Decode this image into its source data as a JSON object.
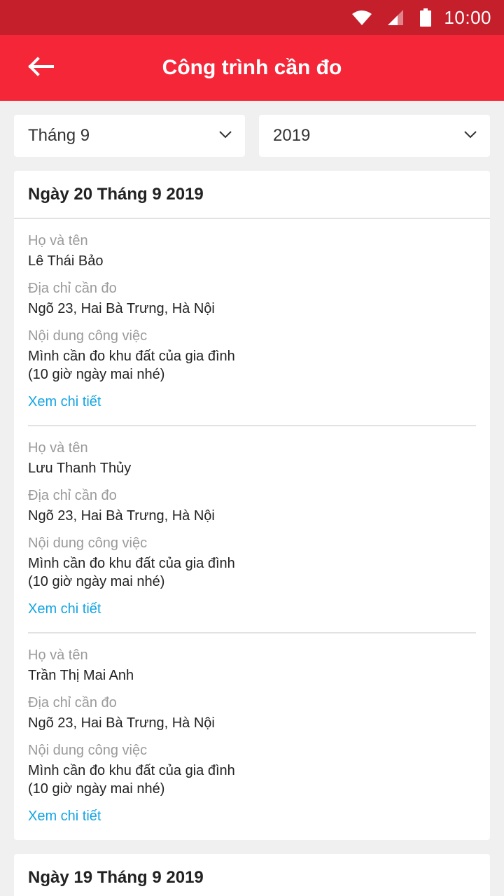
{
  "status_bar": {
    "time": "10:00"
  },
  "app_bar": {
    "title": "Công trình cần đo"
  },
  "filters": {
    "month": "Tháng 9",
    "year": "2019"
  },
  "groups": [
    {
      "date": "Ngày 20 Tháng 9 2019",
      "entries": [
        {
          "name_label": "Họ và tên",
          "name": "Lê Thái Bảo",
          "address_label": "Địa chỉ cần đo",
          "address": "Ngõ 23, Hai Bà Trưng, Hà Nội",
          "content_label": "Nội dung công việc",
          "content_line1": "Mình cần đo khu đất của gia đình",
          "content_line2": "(10 giờ ngày mai nhé)",
          "details_link": "Xem chi tiết"
        },
        {
          "name_label": "Họ và tên",
          "name": "Lưu Thanh Thủy",
          "address_label": "Địa chỉ cần đo",
          "address": "Ngõ 23, Hai Bà Trưng, Hà Nội",
          "content_label": "Nội dung công việc",
          "content_line1": "Mình cần đo khu đất của gia đình",
          "content_line2": "(10 giờ ngày mai nhé)",
          "details_link": "Xem chi tiết"
        },
        {
          "name_label": "Họ và tên",
          "name": "Trần Thị Mai Anh",
          "address_label": "Địa chỉ cần đo",
          "address": "Ngõ 23, Hai Bà Trưng, Hà Nội",
          "content_label": "Nội dung công việc",
          "content_line1": "Mình cần đo khu đất của gia đình",
          "content_line2": "(10 giờ ngày mai nhé)",
          "details_link": "Xem chi tiết"
        }
      ]
    },
    {
      "date": "Ngày 19 Tháng 9 2019"
    }
  ],
  "icons": {
    "status": [
      "wifi-icon",
      "signal-icon",
      "battery-icon"
    ],
    "back": "arrow-left-icon",
    "dropdown": "chevron-down-icon"
  },
  "colors": {
    "status_bar": "#c41f2b",
    "app_bar": "#f42638",
    "link": "#13a4e3",
    "background": "#f0f0f0",
    "label": "#9a9a9a"
  }
}
